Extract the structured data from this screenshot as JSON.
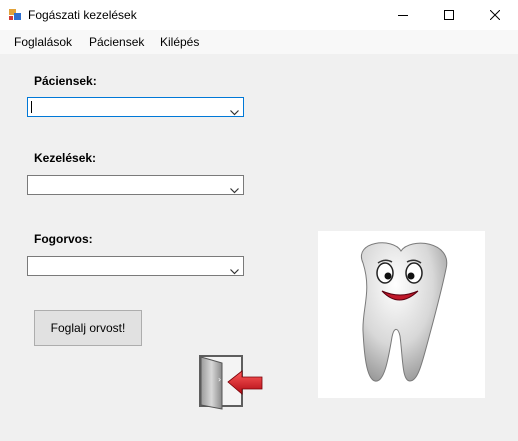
{
  "window": {
    "title": "Fogászati kezelések",
    "icon": "app-icon",
    "controls": [
      "minimize-icon",
      "maximize-icon",
      "close-icon"
    ]
  },
  "menu": {
    "items": [
      "Foglalások",
      "Páciensek",
      "Kilépés"
    ]
  },
  "form": {
    "patients_label": "Páciensek:",
    "patients_value": "",
    "treatments_label": "Kezelések:",
    "treatments_value": "",
    "dentist_label": "Fogorvos:",
    "dentist_value": ""
  },
  "buttons": {
    "book_label": "Foglalj orvost!",
    "exit_icon": "exit-door-icon"
  },
  "image": {
    "name": "tooth-mascot"
  },
  "colors": {
    "window_bg": "#f0f0f0",
    "focus_border": "#0078d7",
    "exit_arrow": "#d9121b"
  }
}
